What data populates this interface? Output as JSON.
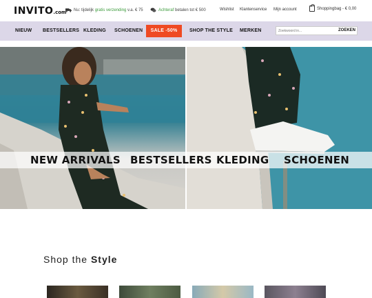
{
  "header": {
    "logo_text": "INVITO",
    "logo_suffix": ".com",
    "usp1_prefix": "Nu: tijdelijk ",
    "usp1_highlight": "gratis verzending",
    "usp1_suffix": " v.a. € 75",
    "usp2_highlight": "Achteraf",
    "usp2_suffix": " betalen tot € 500",
    "wishlist_label": "Wishlist",
    "customer_service_label": "Klantenservice",
    "account_label": "Mijn account",
    "cart_label": "Shoppingbag - € 0,00"
  },
  "nav": {
    "items": [
      "NIEUW",
      "BESTSELLERS",
      "KLEDING",
      "SCHOENEN",
      "SALE -50%",
      "SHOP THE STYLE",
      "MERKEN"
    ],
    "search_placeholder": "Zoekwoord in...",
    "search_button": "ZOEKEN"
  },
  "hero": {
    "categories": [
      "NEW ARRIVALS",
      "BESTSELLERS",
      "KLEDING",
      "SCHOENEN"
    ]
  },
  "section": {
    "title_light": "Shop the ",
    "title_bold": "Style"
  },
  "colors": {
    "nav_bg": "#dcd7e8",
    "sale_bg": "#ef4a23",
    "usp_green": "#3a9a3a"
  }
}
